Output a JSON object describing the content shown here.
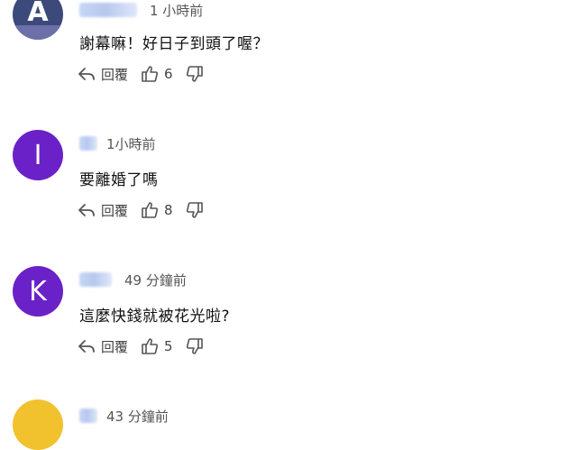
{
  "comments": [
    {
      "avatar_letter": "A",
      "time": "1 小時前",
      "text": "謝幕嘛！好日子到頭了喔？",
      "reply_label": "回覆",
      "likes": "6",
      "avatar_color": "#3b4a7a"
    },
    {
      "avatar_letter": "I",
      "time": "1小時前",
      "text": "要離婚了嗎",
      "reply_label": "回覆",
      "likes": "8",
      "avatar_color": "#6b21c8"
    },
    {
      "avatar_letter": "K",
      "time": "49 分鐘前",
      "text": "這麼快錢就被花光啦?",
      "reply_label": "回覆",
      "likes": "5",
      "avatar_color": "#6b21c8"
    },
    {
      "avatar_letter": "",
      "time": "43 分鐘前",
      "avatar_color": "#f2c12e"
    }
  ],
  "icons": {
    "reply": "reply-arrow-icon",
    "like": "thumbs-up-icon",
    "dislike": "thumbs-down-icon"
  }
}
